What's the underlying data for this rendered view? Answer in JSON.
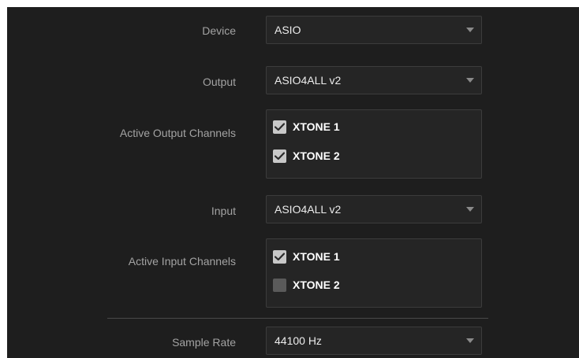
{
  "settings": {
    "device": {
      "label": "Device",
      "value": "ASIO"
    },
    "output": {
      "label": "Output",
      "value": "ASIO4ALL v2"
    },
    "active_output_channels": {
      "label": "Active Output Channels",
      "channels": [
        {
          "name": "XTONE 1",
          "checked": true
        },
        {
          "name": "XTONE 2",
          "checked": true
        }
      ]
    },
    "input": {
      "label": "Input",
      "value": "ASIO4ALL v2"
    },
    "active_input_channels": {
      "label": "Active Input Channels",
      "channels": [
        {
          "name": "XTONE 1",
          "checked": true
        },
        {
          "name": "XTONE 2",
          "checked": false
        }
      ]
    },
    "sample_rate": {
      "label": "Sample Rate",
      "value": "44100 Hz"
    }
  },
  "icons": {
    "dropdown": "chevron-down-icon",
    "check": "checkmark-icon"
  },
  "colors": {
    "panel_bg": "#1e1e1e",
    "control_bg": "#252525",
    "label_text": "#a3a3a3",
    "value_text": "#ececec",
    "checkbox_checked": "#c8c8c8",
    "checkbox_unchecked": "#5a5a5a"
  }
}
